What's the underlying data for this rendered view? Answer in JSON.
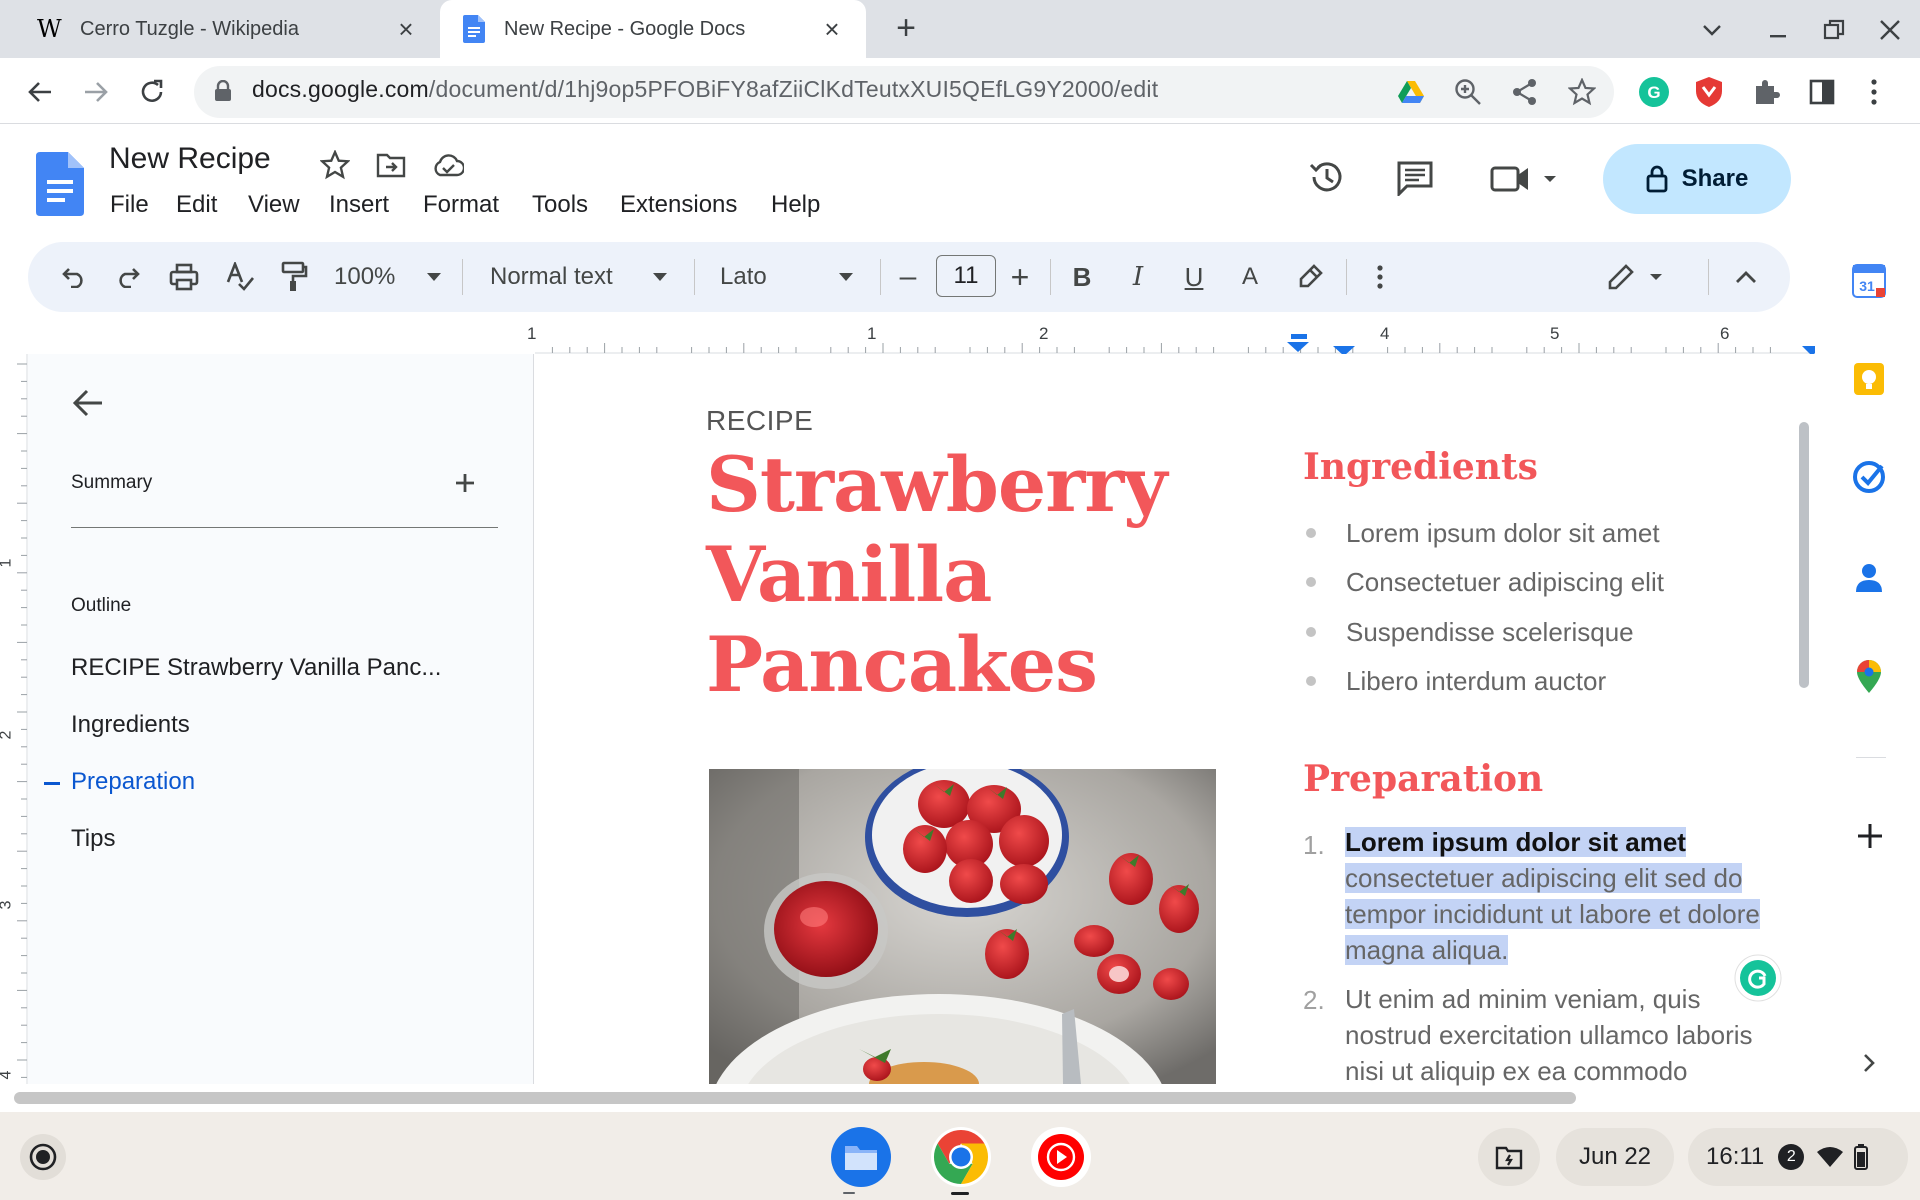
{
  "browser": {
    "tabs": [
      {
        "title": "Cerro Tuzgle - Wikipedia",
        "favicon": "wikipedia-icon"
      },
      {
        "title": "New Recipe - Google Docs",
        "favicon": "docs-icon",
        "active": true
      }
    ],
    "url_host": "docs.google.com",
    "url_path": "/document/d/1hj9op5PFOBiFY8afZiiClKdTeutxXUI5QEfLG9Y2000/edit"
  },
  "doc": {
    "title": "New Recipe",
    "menus": [
      "File",
      "Edit",
      "View",
      "Insert",
      "Format",
      "Tools",
      "Extensions",
      "Help"
    ],
    "share_label": "Share"
  },
  "format_bar": {
    "zoom": "100%",
    "style": "Normal text",
    "font": "Lato",
    "font_size": "11",
    "minus": "–",
    "plus": "+",
    "bold": "B",
    "italic": "I",
    "underline": "U",
    "text_color": "A"
  },
  "ruler": {
    "top_numbers": [
      "1",
      "1",
      "2",
      "4",
      "5",
      "6"
    ],
    "side_numbers": [
      "1",
      "2",
      "3",
      "4"
    ]
  },
  "outline_panel": {
    "summary_label": "Summary",
    "outline_label": "Outline",
    "items": [
      "RECIPE Strawberry Vanilla Panc...",
      "Ingredients",
      "Preparation",
      "Tips"
    ],
    "active_item": "Preparation"
  },
  "content": {
    "kicker": "RECIPE",
    "title_lines": [
      "Strawberry",
      "Vanilla",
      "Pancakes"
    ],
    "ingredients_heading": "Ingredients",
    "ingredients": [
      "Lorem ipsum dolor sit amet",
      "Consectetuer adipiscing elit",
      "Suspendisse scelerisque",
      "Libero interdum auctor"
    ],
    "preparation_heading": "Preparation",
    "steps": [
      {
        "number": "1.",
        "bold": "Lorem ipsum dolor sit amet",
        "text": "consectetuer adipiscing elit sed do tempor incididunt ut labore et dolore magna aliqua."
      },
      {
        "number": "2.",
        "bold": "",
        "text": "Ut enim ad minim veniam, quis nostrud exercitation ullamco laboris nisi ut aliquip ex ea commodo consequat."
      }
    ]
  },
  "shelf": {
    "date": "Jun 22",
    "time": "16:11",
    "notification_count": "2",
    "apps": [
      "files-icon",
      "chrome-icon",
      "youtube-music-icon"
    ]
  },
  "colors": {
    "accent": "#f2575a",
    "docs_blue": "#1a73e8",
    "share_bg": "#c2e7ff",
    "highlight": "#c3d3f5"
  }
}
